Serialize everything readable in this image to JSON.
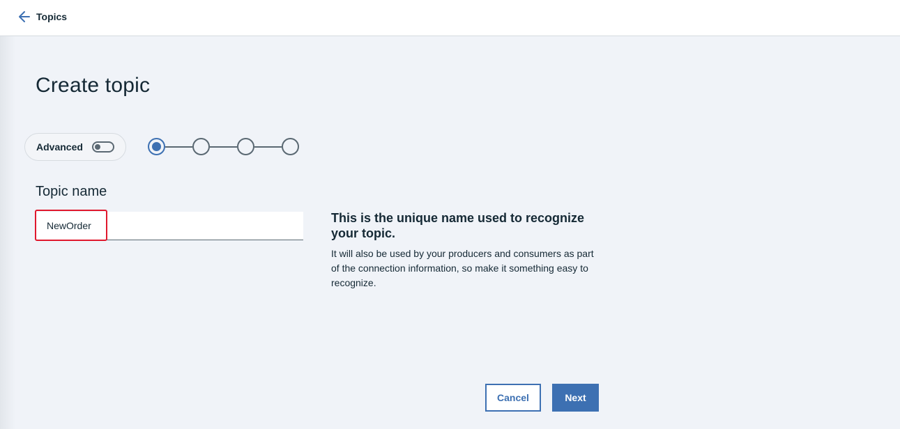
{
  "header": {
    "back_label": "Topics"
  },
  "page": {
    "title": "Create topic"
  },
  "advanced": {
    "label": "Advanced",
    "enabled": false
  },
  "stepper": {
    "total_steps": 4,
    "current_step": 1
  },
  "form": {
    "topic_name_label": "Topic name",
    "topic_name_value": "NewOrder"
  },
  "help": {
    "title": "This is the unique name used to recognize your topic.",
    "text": "It will also be used by your producers and consumers as part of the connection information, so make it something easy to recognize."
  },
  "actions": {
    "cancel_label": "Cancel",
    "next_label": "Next"
  },
  "colors": {
    "accent": "#3d70b2",
    "highlight": "#e0182d",
    "background": "#f0f3f8"
  },
  "icons": {
    "back": "arrow-left-icon"
  }
}
